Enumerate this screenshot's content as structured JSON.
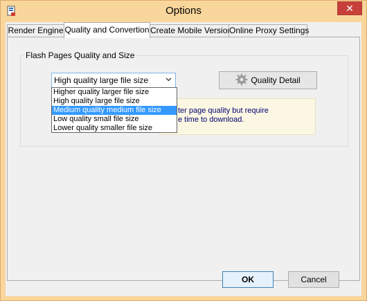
{
  "window": {
    "title": "Options",
    "close_glyph": "✕"
  },
  "tabs": [
    {
      "label": "Render Engine",
      "active": false
    },
    {
      "label": "Quality and Convertion",
      "active": true
    },
    {
      "label": "Create Mobile Version",
      "active": false
    },
    {
      "label": "Online Proxy Settings",
      "active": false
    }
  ],
  "group": {
    "title": "Flash Pages Quality and Size",
    "select_value": "High quality large file size",
    "options": [
      "Higher quality larger file size",
      "High quality large file size",
      "Medium quality medium file size",
      "Low quality small file size",
      "Lower quality smaller file size"
    ],
    "highlighted_option": "Medium quality medium file size",
    "quality_button": "Quality Detail",
    "info_line1": "ter page quality but require",
    "info_line2": "e time to download."
  },
  "buttons": {
    "ok": "OK",
    "cancel": "Cancel"
  },
  "icons": {
    "app": "app-icon",
    "close": "close-icon",
    "gear": "gear-icon",
    "dropdown": "chevron-down-icon"
  },
  "colors": {
    "title_bar": "#f9d69c",
    "close": "#c7403a",
    "selection": "#3399ff",
    "info_bg": "#fbf7e3",
    "info_text": "#00006e"
  }
}
